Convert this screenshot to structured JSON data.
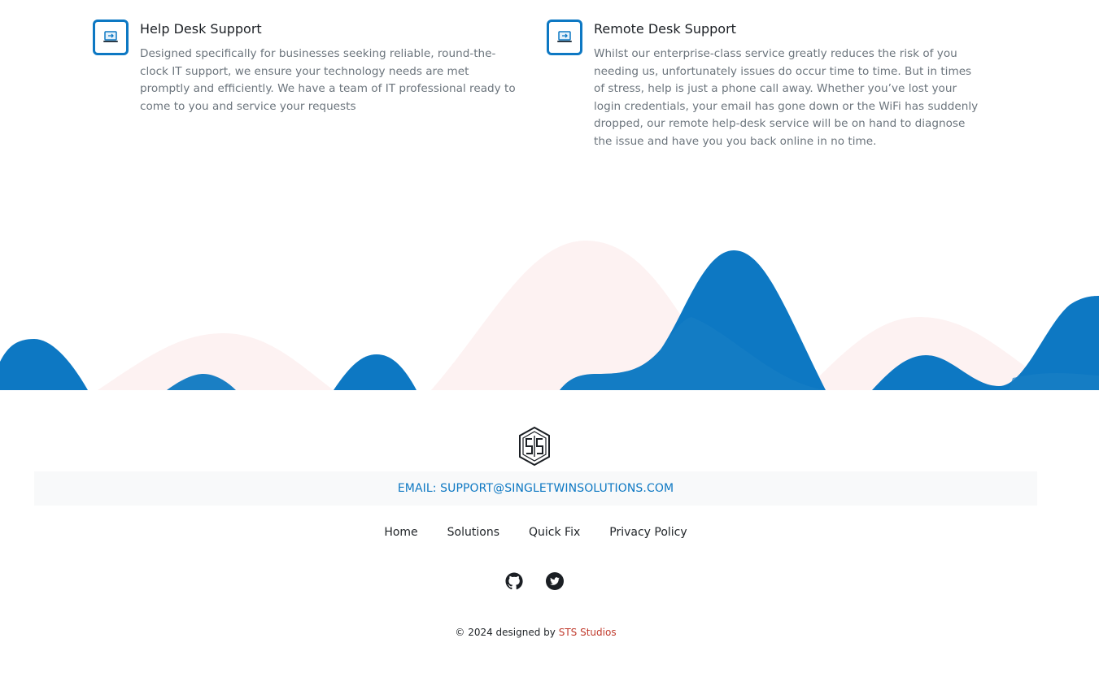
{
  "services": [
    {
      "title": "Help Desk Support",
      "text": "Designed specifically for businesses seeking reliable, round-the-clock IT support, we ensure your technology needs are met promptly and efficiently. We have a team of IT professional ready to come to you and service your requests",
      "icon": "laptop-tools-icon"
    },
    {
      "title": "Remote Desk Support",
      "text": "Whilst our enterprise-class service greatly reduces the risk of you needing us, unfortunately issues do occur time to time. But in times of stress, help is just a phone call away. Whether you’ve lost your login credentials, your email has gone down or the WiFi has suddenly dropped, our remote help-desk service will be on hand to diagnose the issue and have you you back online in no time.",
      "icon": "laptop-tools-icon"
    }
  ],
  "footer": {
    "logo_text": "STS",
    "email": "EMAIL: SUPPORT@SINGLETWINSOLUTIONS.COM",
    "nav": [
      "Home",
      "Solutions",
      "Quick Fix",
      "Privacy Policy"
    ],
    "social_icons": [
      "github-icon",
      "twitter-icon"
    ],
    "copyright_prefix": "© 2024 designed by",
    "copyright_studio": "STS Studios"
  },
  "colors": {
    "accent": "#0d78c3",
    "wave_pink": "#fdf2f2",
    "studio_link": "#c0392b",
    "email_bar_bg": "#f8f9fa"
  }
}
